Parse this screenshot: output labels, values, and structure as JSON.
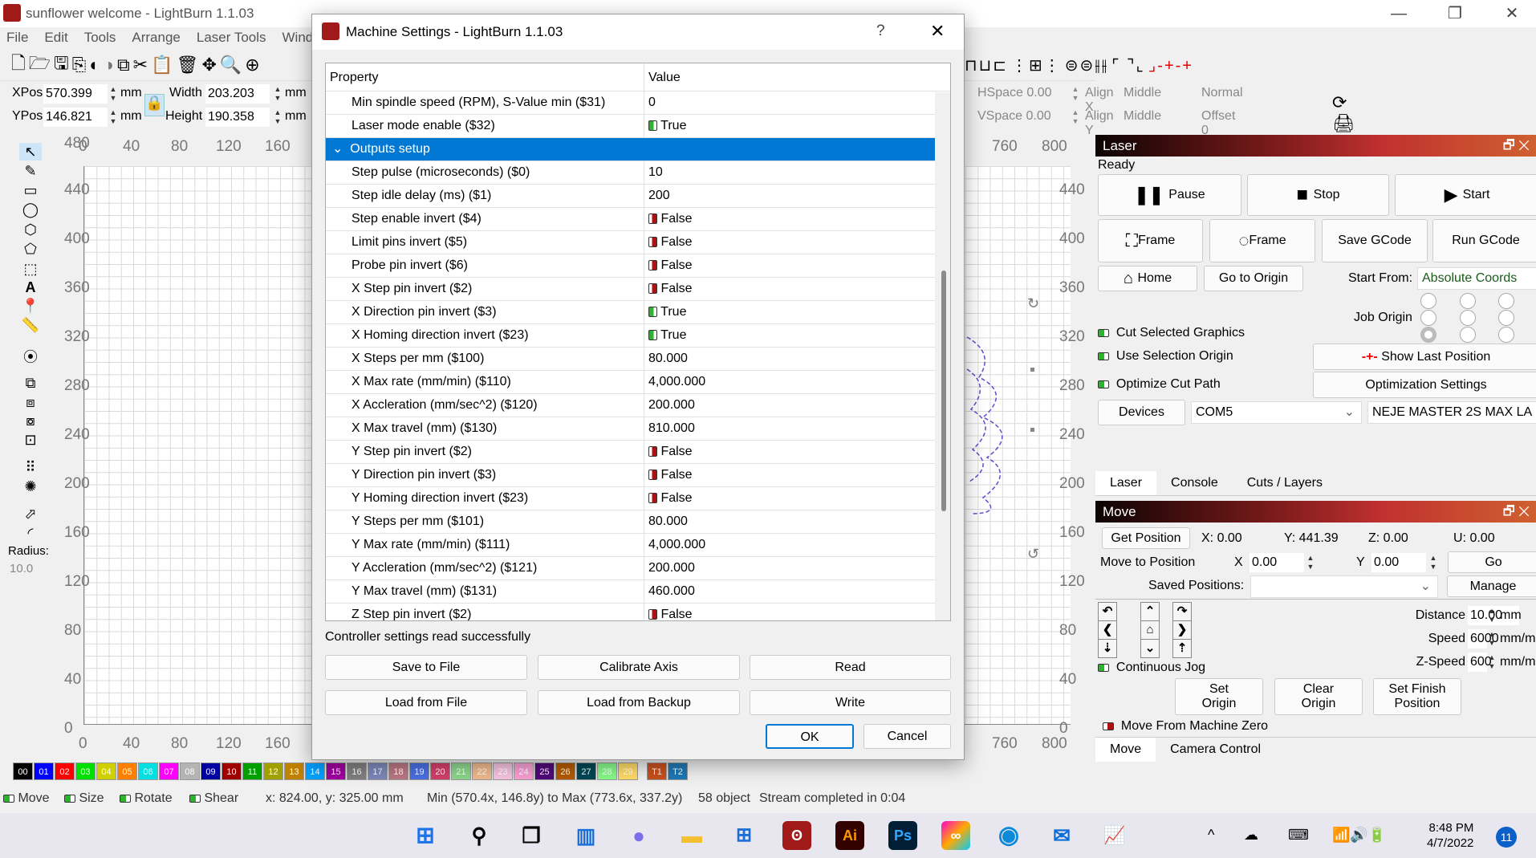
{
  "window": {
    "title": "sunflower welcome - LightBurn 1.1.03",
    "minimize": "—",
    "restore": "❐",
    "close": "✕"
  },
  "menu": [
    "File",
    "Edit",
    "Tools",
    "Arrange",
    "Laser Tools",
    "Windo"
  ],
  "toolbar_icons": [
    "new-file",
    "open",
    "save",
    "import",
    "undo",
    "redo",
    "copy",
    "cut",
    "paste",
    "delete",
    "move",
    "zoom-fit",
    "zoom-in",
    "zoom-out"
  ],
  "position": {
    "xpos_label": "XPos",
    "xpos": "570.399",
    "ypos_label": "YPos",
    "ypos": "146.821",
    "width_label": "Width",
    "width": "203.203",
    "height_label": "Height",
    "height": "190.358",
    "unit": "mm"
  },
  "arrange": {
    "hspace": "HSpace 0.00",
    "vspace": "VSpace 0.00",
    "alignx_label": "Align X",
    "alignx": "Middle",
    "aligny_label": "Align Y",
    "aligny": "Middle",
    "mode": "Normal",
    "offset": "Offset 0"
  },
  "tools": {
    "radius_label": "Radius:",
    "radius": "10.0"
  },
  "rulers": {
    "top": [
      "0",
      "40",
      "80",
      "120",
      "160"
    ],
    "top_right": [
      "760",
      "800"
    ],
    "left": [
      "480",
      "440",
      "400",
      "360",
      "320",
      "280",
      "240",
      "200",
      "160",
      "120",
      "80",
      "40",
      "0"
    ]
  },
  "dialog": {
    "title": "Machine Settings - LightBurn 1.1.03",
    "help": "?",
    "close": "✕",
    "col_property": "Property",
    "col_value": "Value",
    "rows": [
      {
        "p": "Min spindle speed (RPM), S-Value min ($31)",
        "v": "0"
      },
      {
        "p": "Laser mode enable ($32)",
        "v": "True",
        "toggle": true
      },
      {
        "group": "Outputs setup"
      },
      {
        "p": "Step pulse (microseconds) ($0)",
        "v": "10"
      },
      {
        "p": "Step idle delay (ms) ($1)",
        "v": "200"
      },
      {
        "p": "Step enable invert ($4)",
        "v": "False",
        "toggle": false
      },
      {
        "p": "Limit pins invert ($5)",
        "v": "False",
        "toggle": false
      },
      {
        "p": "Probe pin invert ($6)",
        "v": "False",
        "toggle": false
      },
      {
        "p": "X Step pin invert ($2)",
        "v": "False",
        "toggle": false
      },
      {
        "p": "X Direction pin invert ($3)",
        "v": "True",
        "toggle": true
      },
      {
        "p": "X Homing direction invert ($23)",
        "v": "True",
        "toggle": true
      },
      {
        "p": "X Steps per mm ($100)",
        "v": "80.000"
      },
      {
        "p": "X Max rate (mm/min) ($110)",
        "v": "4,000.000"
      },
      {
        "p": "X Accleration (mm/sec^2) ($120)",
        "v": "200.000"
      },
      {
        "p": "X Max travel (mm) ($130)",
        "v": "810.000"
      },
      {
        "p": "Y Step pin invert ($2)",
        "v": "False",
        "toggle": false
      },
      {
        "p": "Y Direction pin invert ($3)",
        "v": "False",
        "toggle": false
      },
      {
        "p": "Y Homing direction invert ($23)",
        "v": "False",
        "toggle": false
      },
      {
        "p": "Y Steps per mm ($101)",
        "v": "80.000"
      },
      {
        "p": "Y Max rate (mm/min) ($111)",
        "v": "4,000.000"
      },
      {
        "p": "Y Accleration (mm/sec^2) ($121)",
        "v": "200.000"
      },
      {
        "p": "Y Max travel (mm) ($131)",
        "v": "460.000"
      },
      {
        "p": "Z Step pin invert ($2)",
        "v": "False",
        "toggle": false
      }
    ],
    "status": "Controller settings read successfully",
    "save_to_file": "Save to File",
    "calibrate_axis": "Calibrate Axis",
    "read": "Read",
    "load_from_file": "Load from File",
    "load_from_backup": "Load from Backup",
    "write": "Write",
    "ok": "OK",
    "cancel": "Cancel"
  },
  "laser": {
    "title": "Laser",
    "status": "Ready",
    "pause": "Pause",
    "stop": "Stop",
    "start": "Start",
    "frame1": "Frame",
    "frame2": "Frame",
    "save_gcode": "Save GCode",
    "run_gcode": "Run GCode",
    "home": "Home",
    "go_to_origin": "Go to Origin",
    "start_from_label": "Start From:",
    "start_from": "Absolute Coords",
    "job_origin_label": "Job Origin",
    "job_origin_selected": "bottom-left",
    "cut_selected": "Cut Selected Graphics",
    "use_selection_origin": "Use Selection Origin",
    "optimize_cut_path": "Optimize Cut Path",
    "show_last_position": "Show Last Position",
    "optimization_settings": "Optimization Settings",
    "devices": "Devices",
    "port": "COM5",
    "device": "NEJE MASTER 2S MAX LA"
  },
  "tabs": [
    "Laser",
    "Console",
    "Cuts / Layers"
  ],
  "move": {
    "title": "Move",
    "get_position": "Get Position",
    "x": "X: 0.00",
    "y": "Y: 441.39",
    "z": "Z: 0.00",
    "u": "U: 0.00",
    "move_to_label": "Move to Position",
    "x_label": "X",
    "x_value": "0.00",
    "y_label": "Y",
    "y_value": "0.00",
    "go": "Go",
    "saved_label": "Saved Positions:",
    "saved_value": "",
    "manage": "Manage",
    "distance_label": "Distance",
    "distance": "10.00",
    "distance_unit": "mm",
    "speed_label": "Speed",
    "speed": "6000",
    "speed_unit": "mm/m",
    "zspeed_label": "Z-Speed",
    "zspeed": "600",
    "zspeed_unit": "mm/m",
    "continuous_jog": "Continuous Jog",
    "set_origin": "Set Origin",
    "clear_origin": "Clear Origin",
    "set_finish": "Set Finish Position",
    "move_from_zero": "Move From Machine Zero"
  },
  "bottom_tabs": [
    "Move",
    "Camera Control"
  ],
  "palette": [
    {
      "l": "00",
      "c": "#000000"
    },
    {
      "l": "01",
      "c": "#0000ff"
    },
    {
      "l": "02",
      "c": "#ff0000"
    },
    {
      "l": "03",
      "c": "#00e000"
    },
    {
      "l": "04",
      "c": "#d0d000"
    },
    {
      "l": "05",
      "c": "#ff8000"
    },
    {
      "l": "06",
      "c": "#00e0e0"
    },
    {
      "l": "07",
      "c": "#ff00ff"
    },
    {
      "l": "08",
      "c": "#b4b4b4"
    },
    {
      "l": "09",
      "c": "#0000a0"
    },
    {
      "l": "10",
      "c": "#a00000"
    },
    {
      "l": "11",
      "c": "#00a000"
    },
    {
      "l": "12",
      "c": "#a0a000"
    },
    {
      "l": "13",
      "c": "#c08000"
    },
    {
      "l": "14",
      "c": "#00a0ff"
    },
    {
      "l": "15",
      "c": "#a000a0"
    },
    {
      "l": "16",
      "c": "#808080"
    },
    {
      "l": "17",
      "c": "#7d87b9"
    },
    {
      "l": "18",
      "c": "#bb7784"
    },
    {
      "l": "19",
      "c": "#4a6fe3"
    },
    {
      "l": "20",
      "c": "#d33f6a"
    },
    {
      "l": "21",
      "c": "#8cd78c"
    },
    {
      "l": "22",
      "c": "#f0b98d"
    },
    {
      "l": "23",
      "c": "#f6c4e1"
    },
    {
      "l": "24",
      "c": "#fa9ed4"
    },
    {
      "l": "25",
      "c": "#500a78"
    },
    {
      "l": "26",
      "c": "#b45a00"
    },
    {
      "l": "27",
      "c": "#004754"
    },
    {
      "l": "28",
      "c": "#86fa88"
    },
    {
      "l": "29",
      "c": "#ffdb66"
    },
    {
      "l": "T1",
      "c": "#c8501e"
    },
    {
      "l": "T2",
      "c": "#1e78b4"
    }
  ],
  "status": {
    "move": "Move",
    "size": "Size",
    "rotate": "Rotate",
    "shear": "Shear",
    "cursor": "x: 824.00, y: 325.00 mm",
    "bounds": "Min (570.4x, 146.8y) to Max (773.6x, 337.2y)",
    "objects": "58 object",
    "message": "Stream completed in 0:04"
  },
  "taskbar": {
    "time": "8:48 PM",
    "date": "4/7/2022",
    "notifications": "11"
  }
}
